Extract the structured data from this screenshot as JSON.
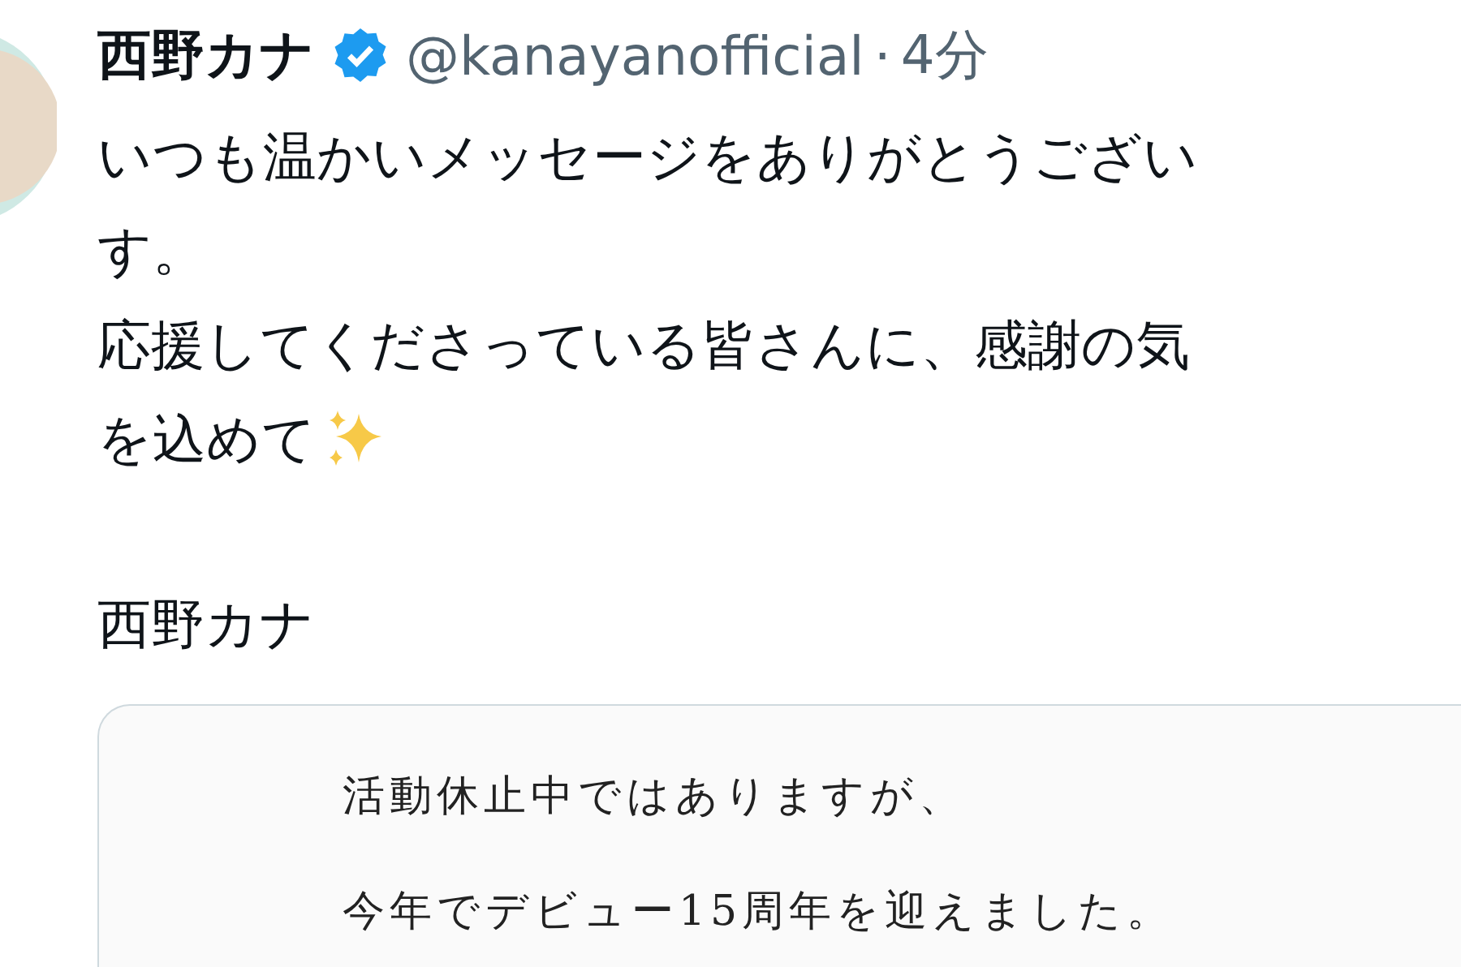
{
  "tweet": {
    "author": {
      "name": "西野カナ",
      "verified": true,
      "handle": "@kanayanofficial",
      "separator": "·",
      "time": "4分"
    },
    "lines": [
      "いつも温かいメッセージをありがとうござい",
      "す。",
      "応援してくださっている皆さんに、感謝の気",
      "を込めて"
    ],
    "signature": "西野カナ",
    "attachment": {
      "lines": [
        "活動休止中ではありますが、",
        "今年でデビュー15周年を迎えました。"
      ]
    }
  }
}
